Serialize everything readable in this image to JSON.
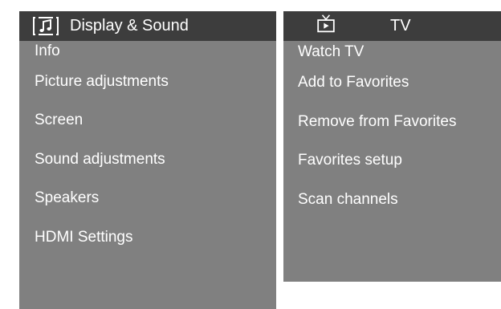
{
  "display_sound_panel": {
    "title": "Display & Sound",
    "icon": "music-note-icon",
    "items": [
      {
        "label": "Info"
      },
      {
        "label": "Picture adjustments"
      },
      {
        "label": "Screen"
      },
      {
        "label": "Sound adjustments"
      },
      {
        "label": "Speakers"
      },
      {
        "label": "HDMI Settings"
      }
    ]
  },
  "tv_panel": {
    "title": "TV",
    "icon": "tv-icon",
    "items": [
      {
        "label": "Watch TV"
      },
      {
        "label": "Add to Favorites"
      },
      {
        "label": "Remove from Favorites"
      },
      {
        "label": "Favorites setup"
      },
      {
        "label": "Scan channels"
      }
    ]
  },
  "colors": {
    "header_background": "#3d3d3d",
    "panel_background": "#808080",
    "text": "#ffffff"
  }
}
